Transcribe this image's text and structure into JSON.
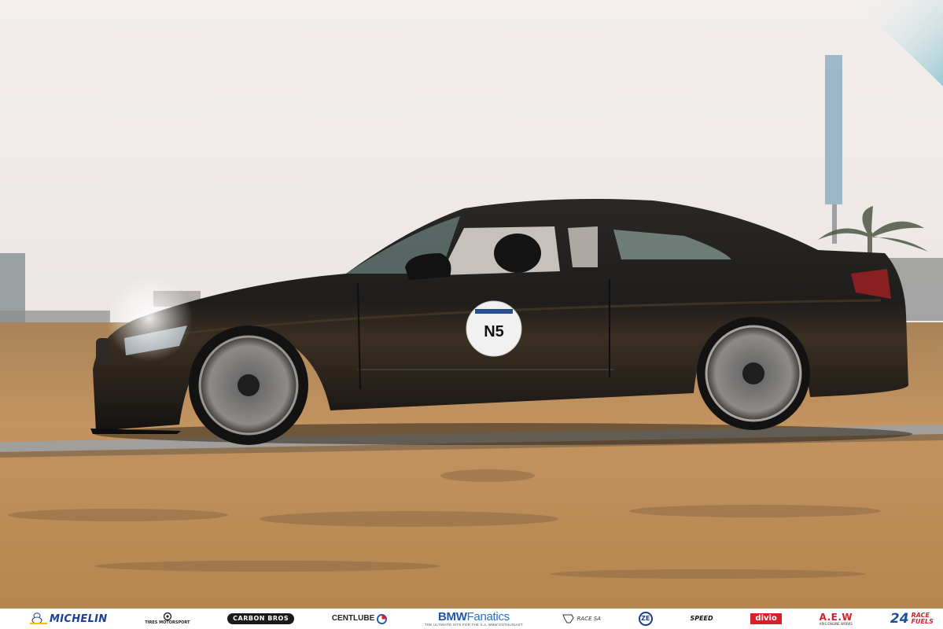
{
  "photo": {
    "car_number": "N5"
  },
  "sponsors": {
    "michelin": "MICHELIN",
    "tires_motorsport": "TIRES MOTORSPORT",
    "carbon_bros": "CARBON BROS",
    "centlube": "CENTLUBE",
    "bmw_fanatics_name": "BMW",
    "bmw_fanatics_suffix": "Fanatics",
    "bmw_fanatics_tagline": "THE ULTIMATE SITE FOR THE S.A. BMW ENTHUSIAST",
    "race_sa": "RACE SA",
    "ze": "ZE",
    "speed_sound": "SPEED",
    "divio": "divio",
    "aew": "A.E.W",
    "aew_tagline": "ARIS ENGINE WORKS",
    "race_fuels_number": "24",
    "race_fuels_word1": "RACE",
    "race_fuels_word2": "FUELS"
  },
  "colors": {
    "sky": "#efe9e6",
    "grass": "#b98a52",
    "track": "#9a9a9a",
    "car_body": "#1c1b1a"
  }
}
